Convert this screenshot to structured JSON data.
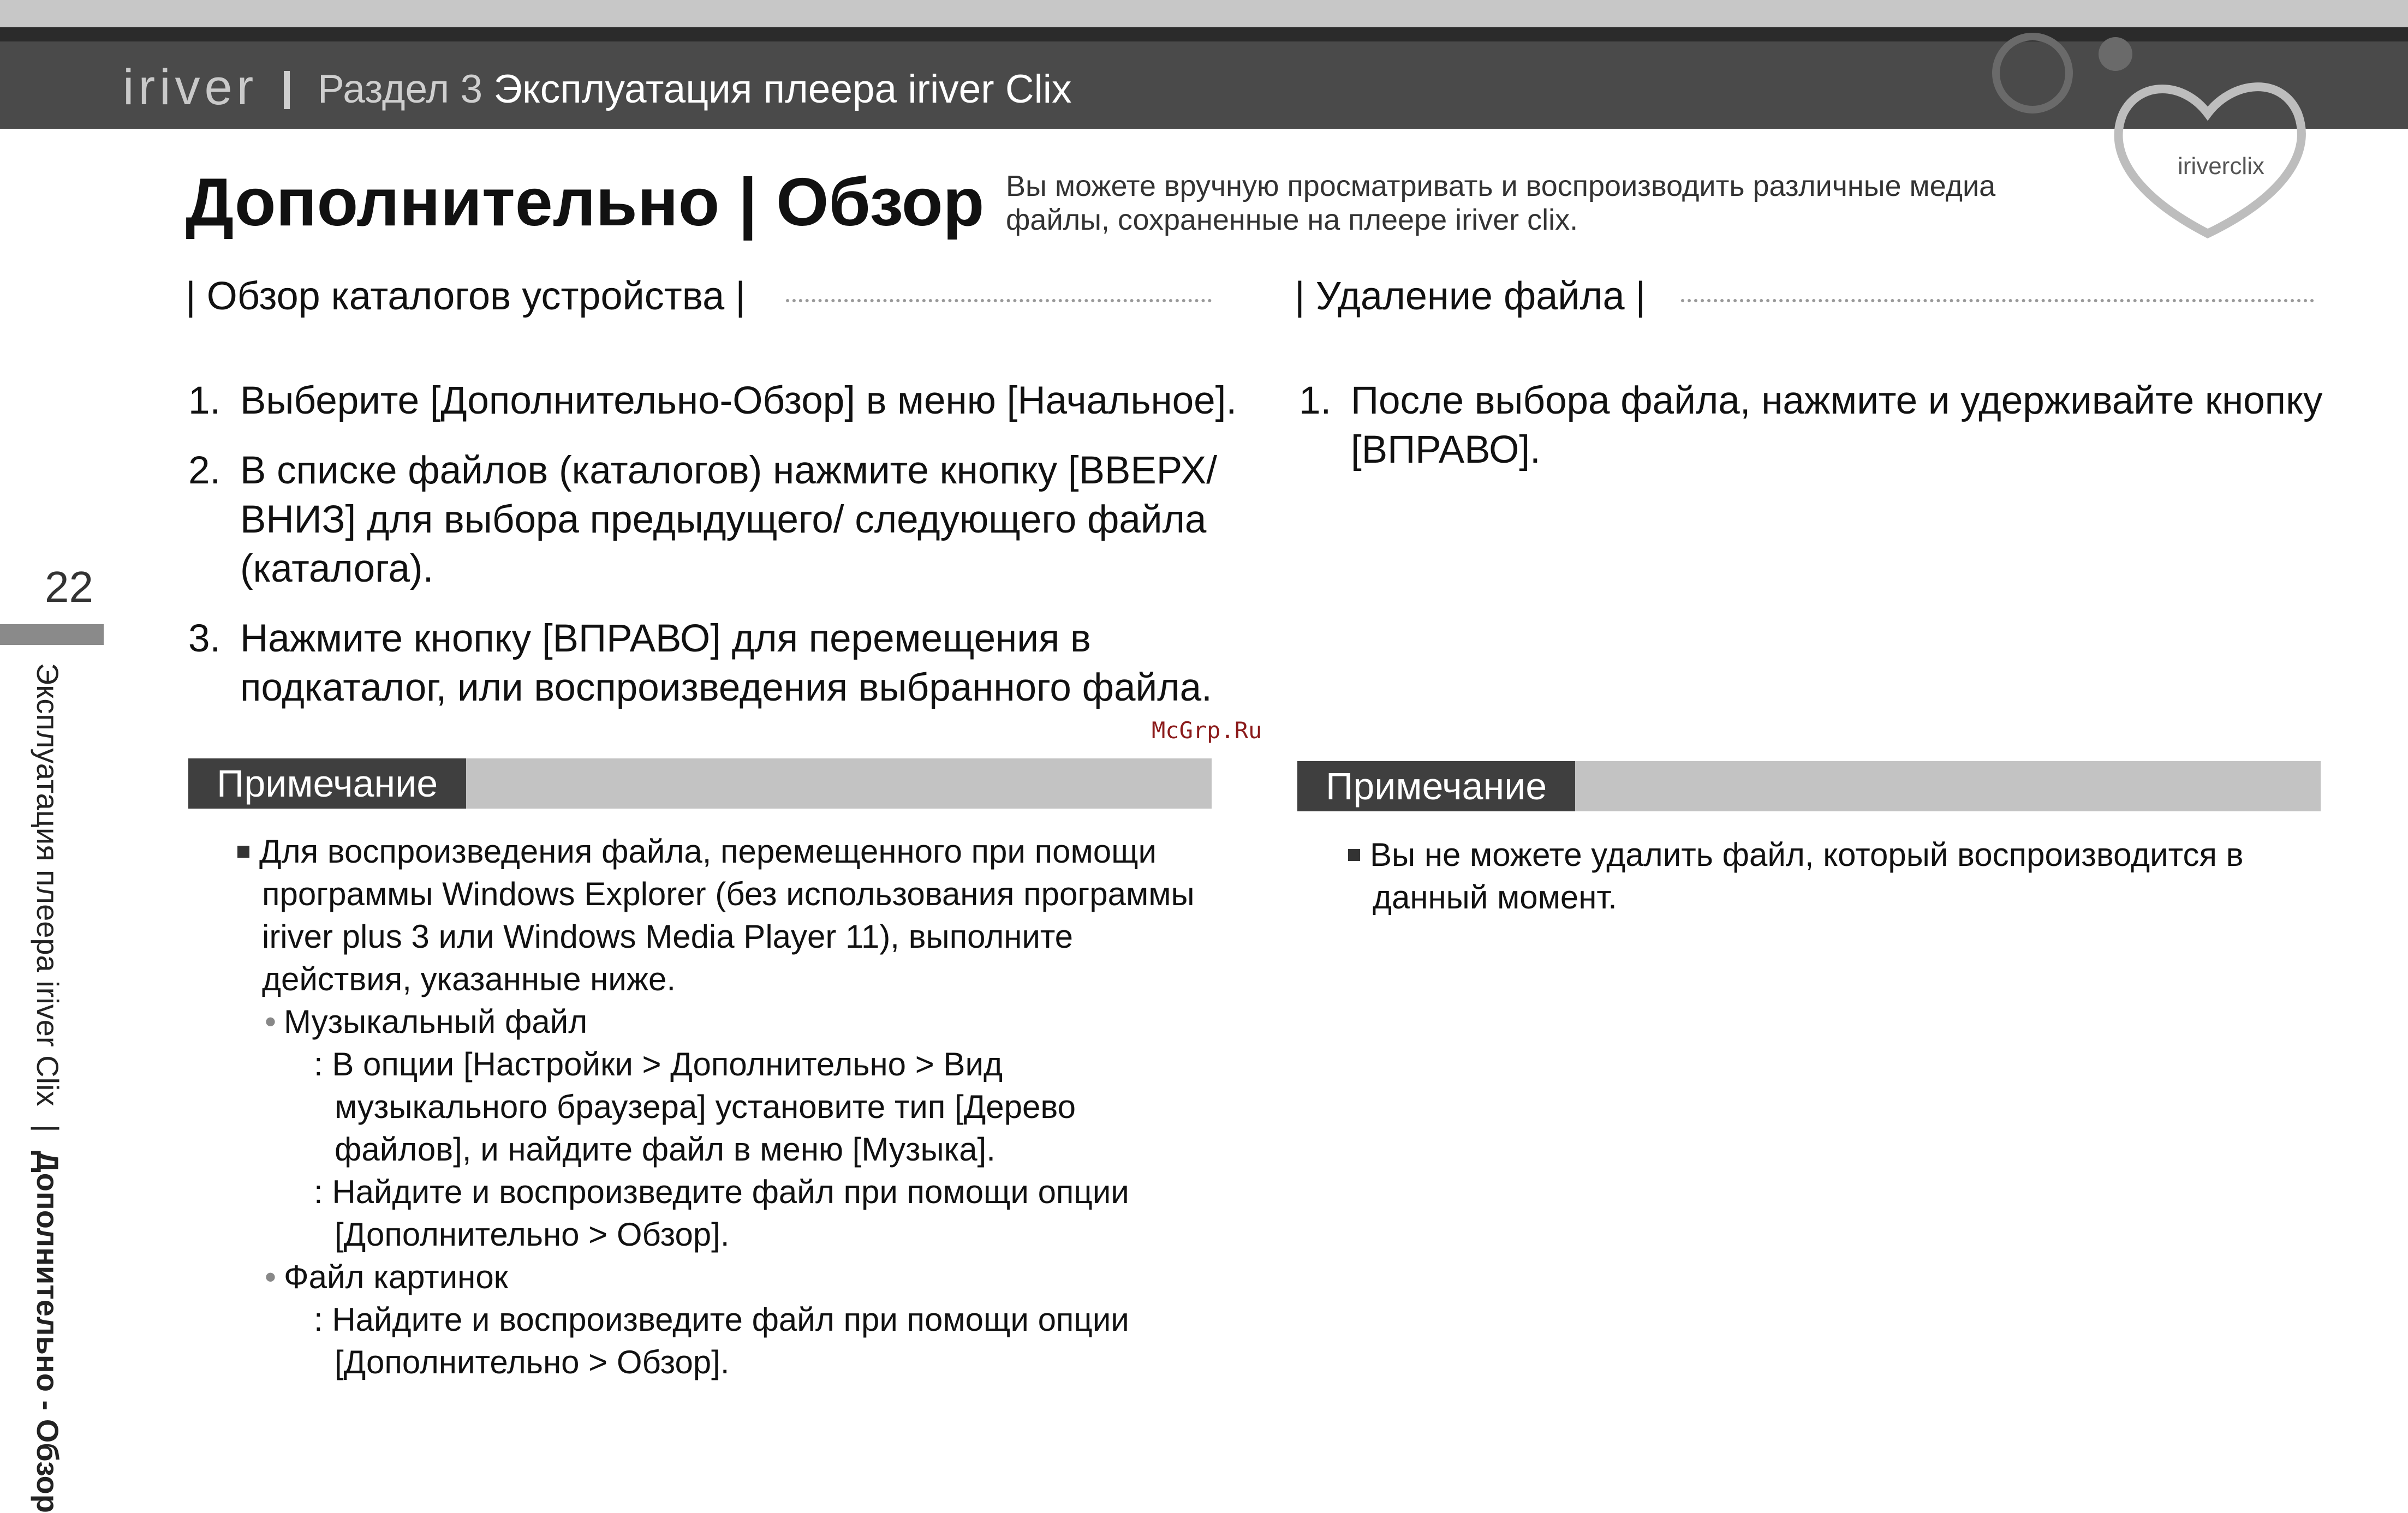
{
  "header": {
    "logo": "iriver",
    "section_label": "Раздел 3",
    "section_title": "Эксплуатация плеера iriver Clix",
    "brand_mark": "iriverclix"
  },
  "title": "Дополнительно | Обзор",
  "intro": "Вы можете вручную просматривать и воспроизводить различные медиа файлы, сохраненные на плеере iriver clix.",
  "left": {
    "heading": "| Обзор каталогов устройства |",
    "steps": [
      {
        "num": "1.",
        "text": "Выберите [Дополнительно-Обзор] в меню [Начальное]."
      },
      {
        "num": "2.",
        "text": "В списке файлов (каталогов) нажмите кнопку [ВВЕРХ/ВНИЗ] для выбора предыдущего/ следующего файла (каталога)."
      },
      {
        "num": "3.",
        "text": "Нажмите кнопку [ВПРАВО] для перемещения в подкаталог, или воспроизведения выбранного файла."
      }
    ],
    "note_label": "Примечание",
    "note": {
      "main": "Для воспроизведения файла, перемещенного при помощи программы Windows Explorer (без использования программы iriver plus 3 или Windows Media Player 11), выполните действия, указанные ниже.",
      "items": [
        {
          "title": "Музыкальный файл",
          "lines": [
            "В опции [Настройки > Дополнительно > Вид музыкального браузера] установите тип [Дерево файлов], и найдите файл в меню [Музыка].",
            "Найдите и воспроизведите файл при помощи опции [Дополнительно > Обзор]."
          ]
        },
        {
          "title": "Файл картинок",
          "lines": [
            "Найдите и воспроизведите файл при помощи опции [Дополнительно > Обзор]."
          ]
        }
      ]
    }
  },
  "right": {
    "heading": "| Удаление файла |",
    "steps": [
      {
        "num": "1.",
        "text": "После выбора файла, нажмите и удерживайте кнопку [ВПРАВО]."
      }
    ],
    "note_label": "Примечание",
    "note_text": "Вы не можете удалить файл, который воспроизводится в данный момент."
  },
  "side": {
    "page_number": "22",
    "chapter": "Эксплуатация плеера iriver Clix",
    "topic": "Дополнительно - Обзор"
  },
  "watermark": "McGrp.Ru"
}
